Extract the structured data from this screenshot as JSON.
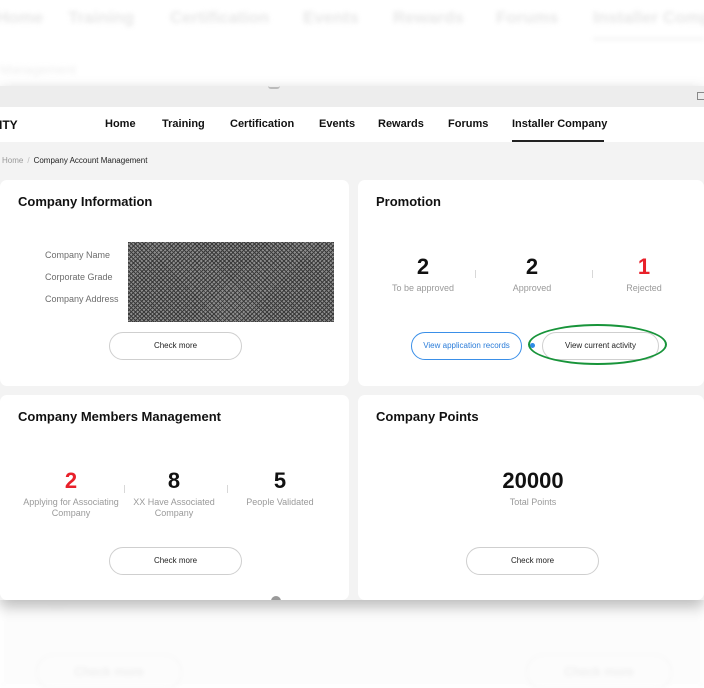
{
  "background": {
    "nav": [
      "Home",
      "Training",
      "Certification",
      "Events",
      "Rewards",
      "Forums",
      "Installer Compa"
    ],
    "breadcrumb": "Management",
    "check_more": "Check more",
    "faint_text": "----"
  },
  "brand": "ITY",
  "nav": {
    "items": [
      "Home",
      "Training",
      "Certification",
      "Events",
      "Rewards",
      "Forums",
      "Installer Company"
    ],
    "active_index": 6
  },
  "breadcrumb": {
    "home": "Home",
    "separator": "/",
    "current": "Company Account Management"
  },
  "company_info": {
    "title": "Company Information",
    "fields": [
      "Company Name",
      "Corporate Grade",
      "Company Address"
    ],
    "button": "Check more"
  },
  "promotion": {
    "title": "Promotion",
    "stats": [
      {
        "value": "2",
        "label": "To be approved"
      },
      {
        "value": "2",
        "label": "Approved"
      },
      {
        "value": "1",
        "label": "Rejected"
      }
    ],
    "records_button": "View application records",
    "activity_button": "View current activity"
  },
  "members": {
    "title": "Company Members Management",
    "stats": [
      {
        "value": "2",
        "label": "Applying for Associating Company"
      },
      {
        "value": "8",
        "label": "XX Have Associated Company"
      },
      {
        "value": "5",
        "label": "People Validated"
      }
    ],
    "button": "Check more"
  },
  "points": {
    "title": "Company Points",
    "value": "20000",
    "label": "Total Points",
    "button": "Check more"
  },
  "colors": {
    "accent_red": "#e8202a",
    "accent_blue": "#2d8ae6",
    "highlight_green": "#18943a",
    "panel_bg": "#f3f3f3"
  },
  "icons": {
    "window_control": "square-icon",
    "indicator_dot": "dot-icon"
  }
}
